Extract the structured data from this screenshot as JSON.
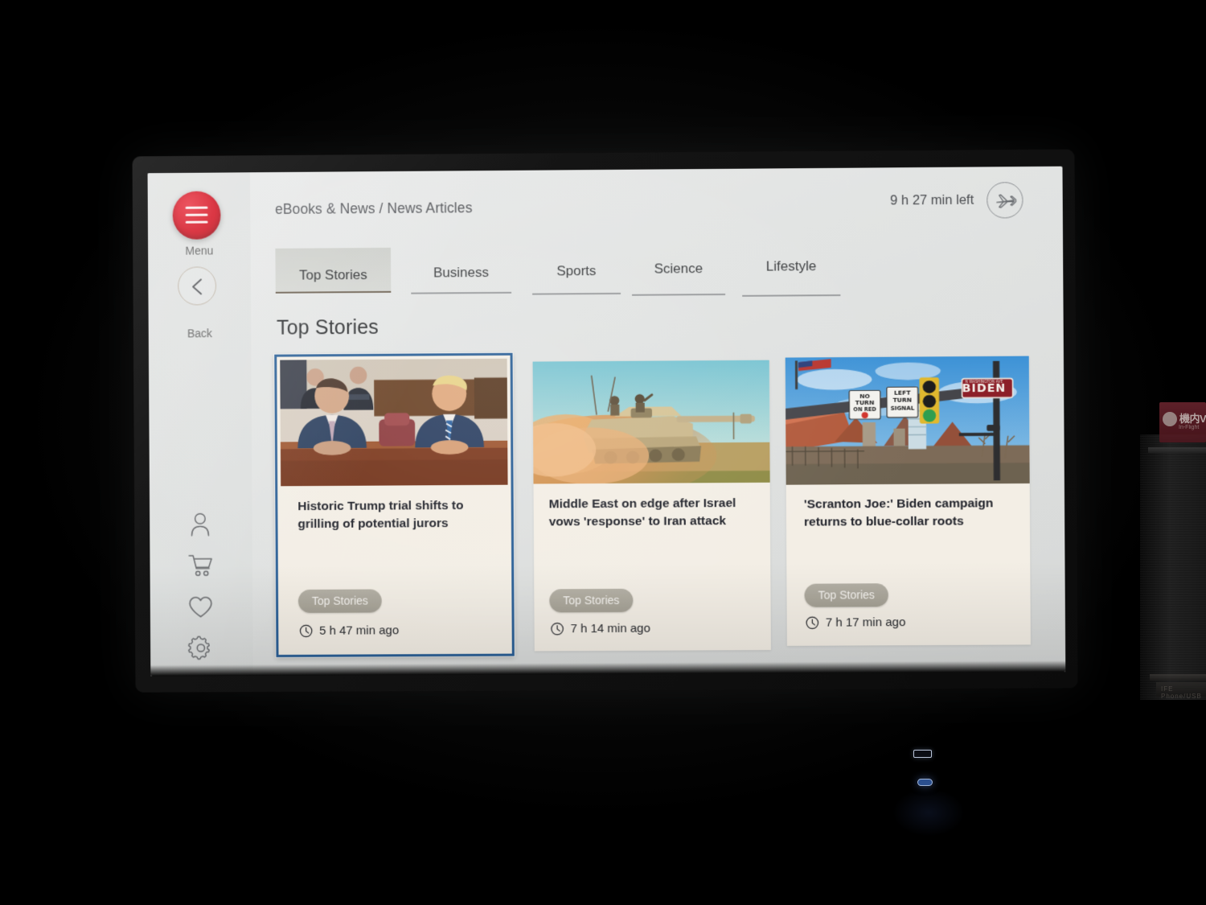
{
  "header": {
    "breadcrumb": "eBooks & News / News Articles",
    "flight_time_left": "9 h 27 min left",
    "plane_icon": "airplane-icon"
  },
  "rail": {
    "menu_label": "Menu",
    "back_label": "Back",
    "menu_icon": "hamburger-menu-icon",
    "back_icon": "chevron-left-icon",
    "icons": [
      {
        "name": "profile-icon"
      },
      {
        "name": "shopping-cart-icon"
      },
      {
        "name": "heart-icon"
      },
      {
        "name": "gear-icon"
      }
    ]
  },
  "tabs": [
    {
      "label": "Top Stories",
      "active": true
    },
    {
      "label": "Business",
      "active": false
    },
    {
      "label": "Sports",
      "active": false
    },
    {
      "label": "Science",
      "active": false
    },
    {
      "label": "Lifestyle",
      "active": false
    }
  ],
  "section": {
    "title": "Top Stories"
  },
  "cards": [
    {
      "title": "Historic Trump trial shifts to grilling of potential jurors",
      "category": "Top Stories",
      "time": "5 h 47 min ago",
      "thumb": "courtroom-photo",
      "selected": true
    },
    {
      "title": "Middle East on edge after Israel vows 'response' to Iran attack",
      "category": "Top Stories",
      "time": "7 h 14 min ago",
      "thumb": "tank-in-dust-photo",
      "selected": false
    },
    {
      "title": "'Scranton Joe:' Biden campaign returns to blue-collar roots",
      "category": "Top Stories",
      "time": "7 h 17 min ago",
      "thumb": "biden-street-sign-photo",
      "selected": false
    }
  ],
  "environment": {
    "placard_title": "機内V",
    "placard_subtitle": "In-Flight",
    "cabin_label": "IFE Phone/USB",
    "ports": [
      {
        "name": "usb-a-port"
      },
      {
        "name": "usb-c-port"
      }
    ]
  },
  "colors": {
    "brand_red": "#d4101f",
    "selection_blue": "#2a5f96",
    "screen_bg": "#e2e4e3",
    "card_bg": "#f3eee5",
    "pill_gray": "#a39f93",
    "active_tab_underline": "#6b5f50"
  }
}
